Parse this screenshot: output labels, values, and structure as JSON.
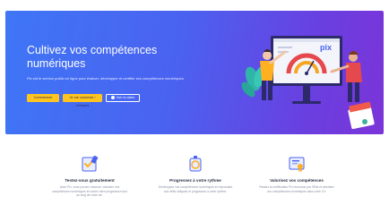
{
  "hero": {
    "title": "Cultivez vos compétences numériques",
    "subtitle": "Pix est le service public en ligne pour évaluer, développer et certifier ses compétences numériques.",
    "buttons": [
      {
        "label": "Commencer"
      },
      {
        "label": "Je me connecte / m’inscris"
      },
      {
        "label": "Voir la vidéo"
      }
    ],
    "colors": {
      "gradient_start": "#3f76f6",
      "gradient_end": "#7b34d8",
      "button": "#ffc51e"
    },
    "illustration_logo": "pix"
  },
  "features": [
    {
      "icon": "checklist-icon",
      "title": "Testez-vous gratuitement",
      "description": "Avec Pix, vous pouvez mesurer, valoriser vos compétences numériques et suivre votre progression tout au long de votre vie."
    },
    {
      "icon": "progress-icon",
      "title": "Progressez à votre rythme",
      "description": "Développez vos compétences numériques en répondant aux défis ludiques et progressez à votre rythme."
    },
    {
      "icon": "certificate-icon",
      "title": "Valorisez vos compétences",
      "description": "Passez la certification Pix reconnue par l’État et valorisez vos compétences numériques dans votre CV."
    }
  ]
}
